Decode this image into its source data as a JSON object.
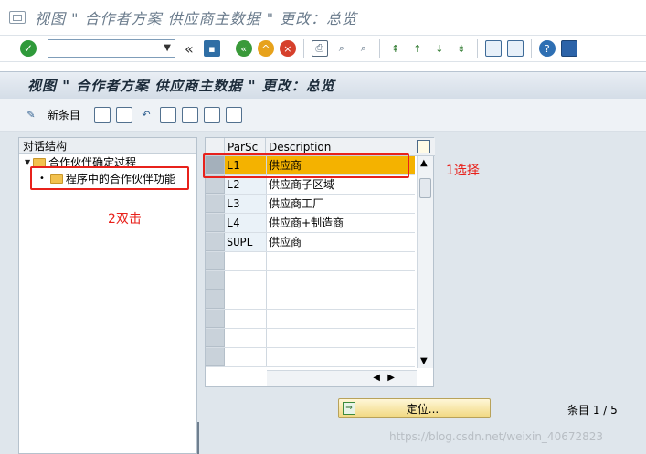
{
  "window": {
    "title": "视图 \" 合作者方案 供应商主数据 \" 更改：总览"
  },
  "system_toolbar": {
    "command_field_value": ""
  },
  "header": {
    "title": "视图 \" 合作者方案 供应商主数据 \" 更改：总览"
  },
  "app_toolbar": {
    "new_entries_label": "新条目"
  },
  "tree": {
    "header": "对话结构",
    "root_label": "合作伙伴确定过程",
    "child_label": "程序中的合作伙伴功能"
  },
  "table": {
    "columns": [
      "ParSc",
      "Description"
    ],
    "rows": [
      {
        "code": "L1",
        "desc": "供应商"
      },
      {
        "code": "L2",
        "desc": "供应商子区域"
      },
      {
        "code": "L3",
        "desc": "供应商工厂"
      },
      {
        "code": "L4",
        "desc": "供应商+制造商"
      },
      {
        "code": "SUPL",
        "desc": "供应商"
      }
    ]
  },
  "annotations": {
    "select": "1选择",
    "double_click": "2双击"
  },
  "bottom": {
    "position_button": "定位...",
    "entries": "条目 1 / 5"
  },
  "watermark": "https://blog.csdn.net/weixin_40672823",
  "colors": {
    "active_row": "#f4b200",
    "annotation": "#e8211b"
  }
}
